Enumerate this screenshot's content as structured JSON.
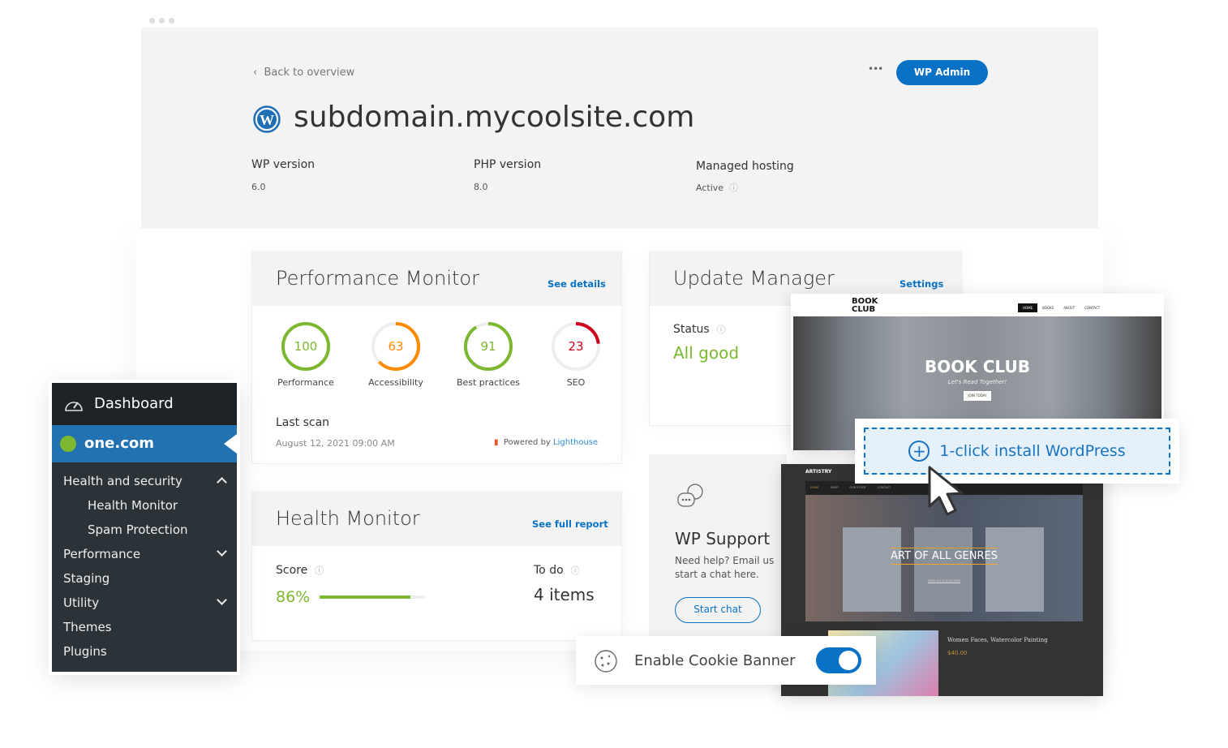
{
  "header": {
    "back_label": "Back to overview",
    "more_icon": "more-dots-icon",
    "wp_admin_label": "WP Admin",
    "site_title": "subdomain.mycoolsite.com",
    "info": [
      {
        "label": "WP version",
        "value": "6.0"
      },
      {
        "label": "PHP version",
        "value": "8.0"
      },
      {
        "label": "Managed hosting",
        "value": "Active"
      }
    ]
  },
  "performance": {
    "title": "Performance Monitor",
    "link": "See details",
    "scores": [
      {
        "label": "Performance",
        "value": "100",
        "pct": 100,
        "color": "#7cb82f"
      },
      {
        "label": "Accessibility",
        "value": "63",
        "pct": 63,
        "color": "#ff8a00"
      },
      {
        "label": "Best practices",
        "value": "91",
        "pct": 91,
        "color": "#7cb82f"
      },
      {
        "label": "SEO",
        "value": "23",
        "pct": 23,
        "color": "#d0021b"
      }
    ],
    "last_scan_label": "Last scan",
    "last_scan_date": "August 12, 2021  09:00 AM",
    "powered_by": "Powered by",
    "lighthouse": "Lighthouse"
  },
  "health": {
    "title": "Health Monitor",
    "link": "See full report",
    "score_label": "Score",
    "score_value": "86%",
    "score_pct": 86,
    "todo_label": "To do",
    "todo_value": "4 items"
  },
  "update": {
    "title": "Update Manager",
    "link": "Settings",
    "status_label": "Status",
    "status_value": "All good"
  },
  "support": {
    "title": "WP Support",
    "text1": "Need help? Email us",
    "text2": "start a chat here.",
    "button": "Start chat"
  },
  "sidebar": {
    "dashboard": "Dashboard",
    "brand": "one.com",
    "items": [
      {
        "label": "Health and security",
        "chev": "up"
      },
      {
        "label": "Health Monitor",
        "sub": true
      },
      {
        "label": "Spam Protection",
        "sub": true
      },
      {
        "label": "Performance",
        "chev": "down"
      },
      {
        "label": "Staging"
      },
      {
        "label": "Utility",
        "chev": "down"
      },
      {
        "label": "Themes"
      },
      {
        "label": "Plugins"
      }
    ]
  },
  "bookclub": {
    "logo1": "BOOK",
    "logo2": "CLUB",
    "nav": [
      "HOME",
      "BOOKS",
      "ABOUT",
      "CONTACT"
    ],
    "hero": "BOOK CLUB",
    "tagline": "Let's Read Together!",
    "cta": "JOIN TODAY"
  },
  "install": {
    "label": "1-click install WordPress"
  },
  "artistry": {
    "logo": "ARTISTRY",
    "nav": [
      "HOME",
      "SHOP",
      "OUR STORY",
      "CONTACT"
    ],
    "hero": "ART OF ALL GENRES",
    "hero_link": "VIEW ALL COLLECTION",
    "product": "Women Faces, Watercolor Painting",
    "price": "$40.00"
  },
  "cookie": {
    "label": "Enable Cookie Banner",
    "enabled": true
  },
  "colors": {
    "accent": "#0a72c6",
    "green": "#7cb82f"
  }
}
